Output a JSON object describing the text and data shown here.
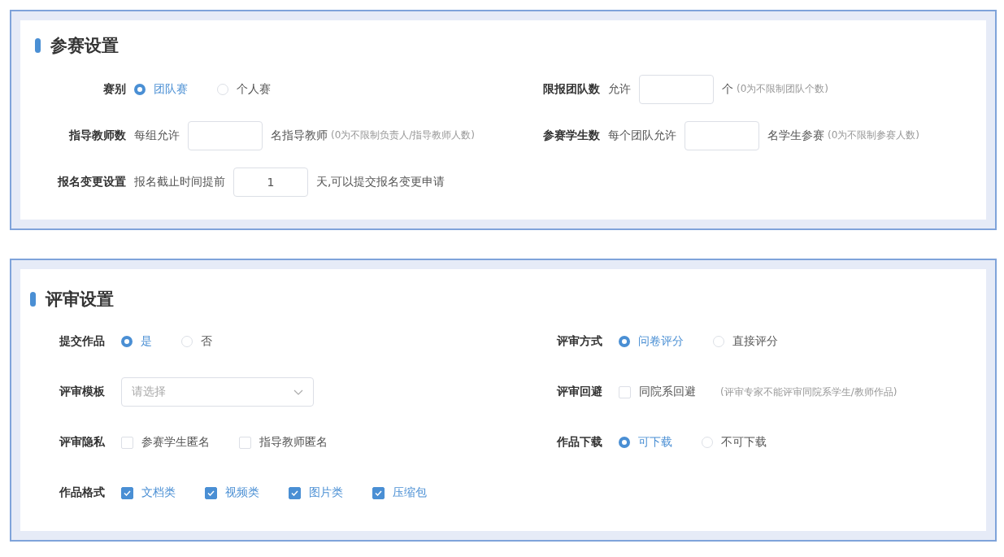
{
  "panels": [
    {
      "title": "参赛设置",
      "left": [
        {
          "kind": "radio",
          "label": "赛别",
          "options": [
            {
              "label": "团队赛",
              "selected": true
            },
            {
              "label": "个人赛",
              "selected": false
            }
          ]
        },
        {
          "kind": "input",
          "label": "指导教师数",
          "prefix": "每组允许",
          "suffix": "名指导教师",
          "hint": "(0为不限制负责人/指导教师人数)"
        },
        {
          "kind": "input",
          "label": "报名变更设置",
          "prefix": "报名截止时间提前",
          "value": "1",
          "suffix": "天,可以提交报名变更申请"
        }
      ],
      "right": [
        {
          "kind": "input",
          "label": "限报团队数",
          "prefix": "允许",
          "suffix": "个",
          "hint": "(0为不限制团队个数)"
        },
        {
          "kind": "input",
          "label": "参赛学生数",
          "prefix": "每个团队允许",
          "suffix": "名学生参赛",
          "hint": "(0为不限制参赛人数)"
        }
      ]
    },
    {
      "title": "评审设置",
      "left": [
        {
          "kind": "radio",
          "label": "提交作品",
          "options": [
            {
              "label": "是",
              "selected": true
            },
            {
              "label": "否",
              "selected": false
            }
          ]
        },
        {
          "kind": "select",
          "label": "评审模板",
          "placeholder": "请选择"
        },
        {
          "kind": "checkbox",
          "label": "评审隐私",
          "options": [
            {
              "label": "参赛学生匿名",
              "checked": false
            },
            {
              "label": "指导教师匿名",
              "checked": false
            }
          ]
        },
        {
          "kind": "checkbox",
          "label": "作品格式",
          "options": [
            {
              "label": "文档类",
              "checked": true
            },
            {
              "label": "视频类",
              "checked": true
            },
            {
              "label": "图片类",
              "checked": true
            },
            {
              "label": "压缩包",
              "checked": true
            }
          ]
        }
      ],
      "right": [
        {
          "kind": "radio",
          "label": "评审方式",
          "options": [
            {
              "label": "问卷评分",
              "selected": true
            },
            {
              "label": "直接评分",
              "selected": false
            }
          ]
        },
        {
          "kind": "checkbox",
          "label": "评审回避",
          "options": [
            {
              "label": "同院系回避",
              "checked": false
            }
          ],
          "hint": "(评审专家不能评审同院系学生/教师作品)"
        },
        {
          "kind": "radio",
          "label": "作品下载",
          "options": [
            {
              "label": "可下载",
              "selected": true
            },
            {
              "label": "不可下载",
              "selected": false
            }
          ]
        }
      ]
    }
  ]
}
